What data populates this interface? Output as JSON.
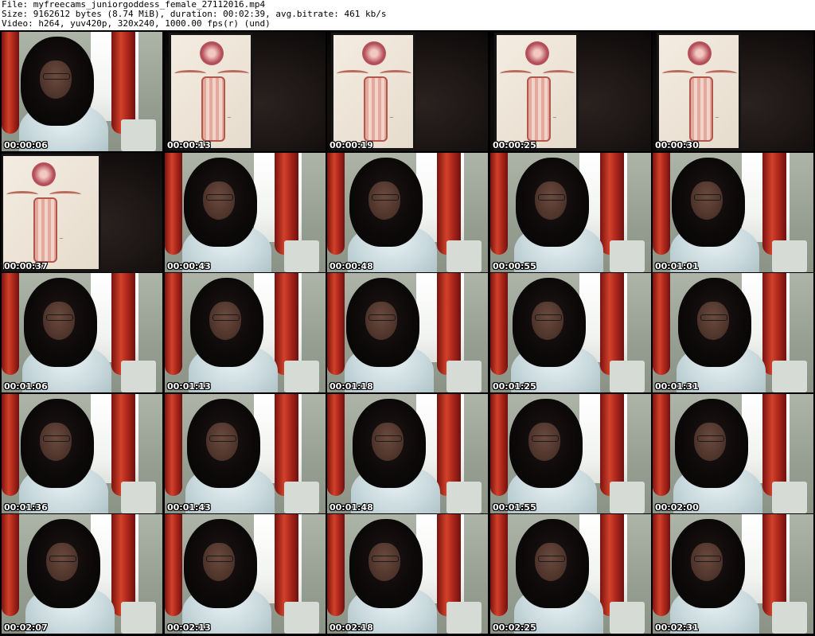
{
  "header": {
    "file_line": "File: myfreecams_juniorgoddess_female_27112016.mp4",
    "size_line": "Size: 9162612 bytes (8.74 MiB), duration: 00:02:39, avg.bitrate: 461 kb/s",
    "video_line": "Video: h264, yuv420p, 320x240, 1000.00 fps(r) (und)"
  },
  "thumbnails": [
    {
      "timestamp": "00:00:06",
      "scene": "webcam"
    },
    {
      "timestamp": "00:00:13",
      "scene": "drawing"
    },
    {
      "timestamp": "00:00:19",
      "scene": "drawing"
    },
    {
      "timestamp": "00:00:25",
      "scene": "drawing"
    },
    {
      "timestamp": "00:00:30",
      "scene": "drawing"
    },
    {
      "timestamp": "00:00:37",
      "scene": "drawing"
    },
    {
      "timestamp": "00:00:43",
      "scene": "webcam"
    },
    {
      "timestamp": "00:00:48",
      "scene": "webcam"
    },
    {
      "timestamp": "00:00:55",
      "scene": "webcam"
    },
    {
      "timestamp": "00:01:01",
      "scene": "webcam"
    },
    {
      "timestamp": "00:01:06",
      "scene": "webcam"
    },
    {
      "timestamp": "00:01:13",
      "scene": "webcam"
    },
    {
      "timestamp": "00:01:18",
      "scene": "webcam"
    },
    {
      "timestamp": "00:01:25",
      "scene": "webcam"
    },
    {
      "timestamp": "00:01:31",
      "scene": "webcam"
    },
    {
      "timestamp": "00:01:36",
      "scene": "webcam"
    },
    {
      "timestamp": "00:01:43",
      "scene": "webcam"
    },
    {
      "timestamp": "00:01:48",
      "scene": "webcam"
    },
    {
      "timestamp": "00:01:55",
      "scene": "webcam"
    },
    {
      "timestamp": "00:02:00",
      "scene": "webcam"
    },
    {
      "timestamp": "00:02:07",
      "scene": "webcam"
    },
    {
      "timestamp": "00:02:13",
      "scene": "webcam"
    },
    {
      "timestamp": "00:02:18",
      "scene": "webcam"
    },
    {
      "timestamp": "00:02:25",
      "scene": "webcam"
    },
    {
      "timestamp": "00:02:31",
      "scene": "webcam"
    }
  ]
}
